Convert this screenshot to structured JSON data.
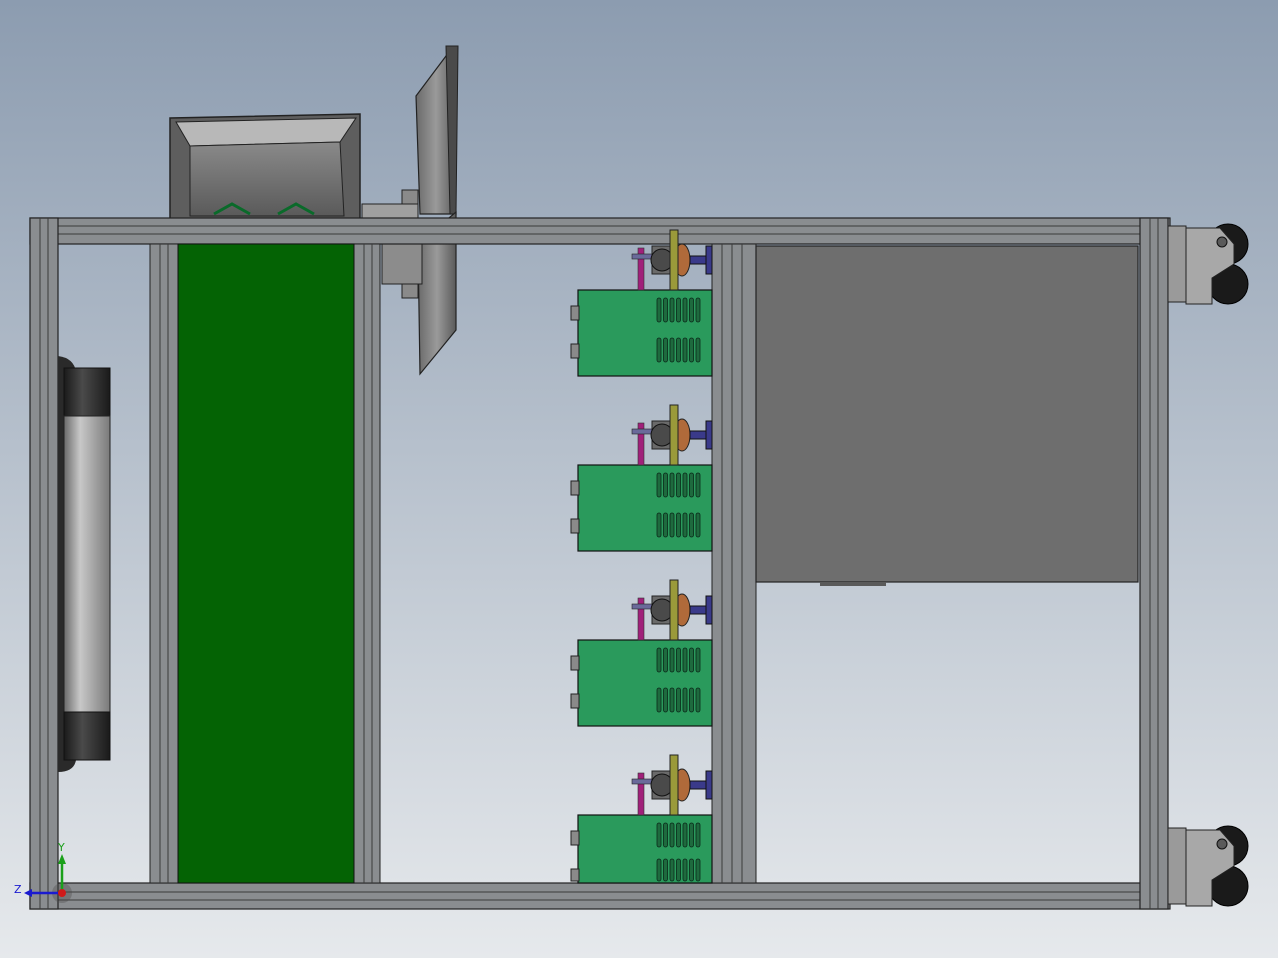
{
  "viewport": {
    "background_top": "#8c9cb0",
    "background_bottom": "#e6e9ec"
  },
  "colors": {
    "frame": "#8a8d90",
    "frame_dark": "#4a4c4e",
    "belt": "#046304",
    "power_supply": "#2a9a5c",
    "panel": "#6e6e6e",
    "motor_shaft": "#a0207a",
    "motor_bracket": "#3a3a8a",
    "motor_ring": "#9a9a3a",
    "roller_end": "#2a2a2a",
    "roller_body": "#9a9a9a",
    "caster_wheel": "#1a1a1a",
    "copper": "#b06a3a"
  },
  "triad": {
    "y_label": "Y",
    "z_label": "Z",
    "y_color": "#1aa01a",
    "z_color": "#1a1ad0",
    "x_color": "#d01a1a"
  },
  "components": {
    "power_supply_count": 4,
    "caster_count": 2,
    "motor_count": 4
  }
}
